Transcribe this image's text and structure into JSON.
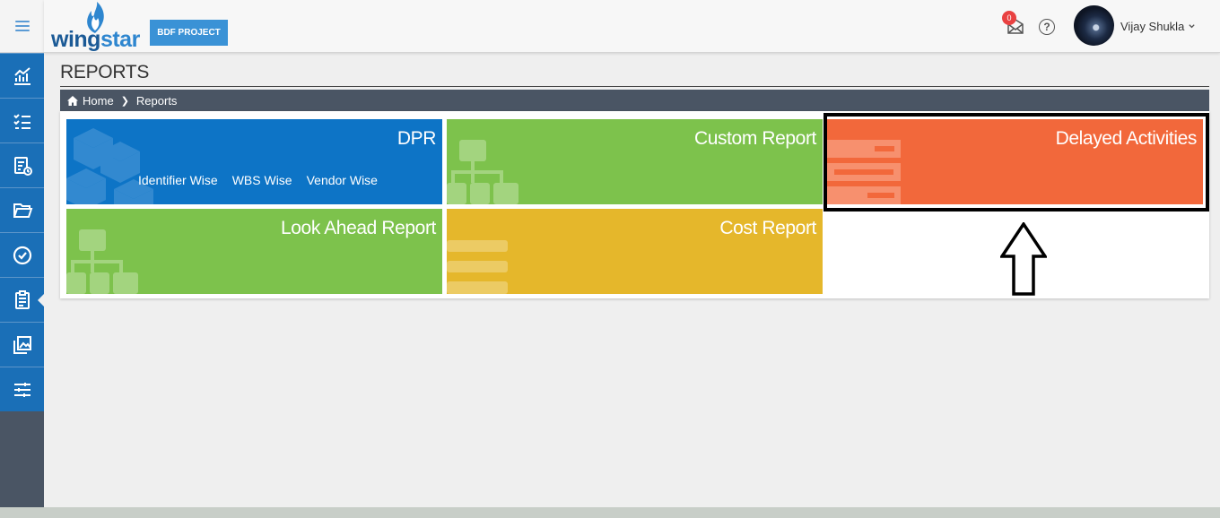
{
  "app": {
    "logo_word_1": "wing",
    "logo_word_2": "star",
    "project_label": "BDF PROJECT"
  },
  "header": {
    "notifications_count": "0",
    "user_name": "Vijay Shukla",
    "help_glyph": "?"
  },
  "sidebar": {
    "items": [
      {
        "icon": "analytics-icon"
      },
      {
        "icon": "checklist-icon"
      },
      {
        "icon": "report-clock-icon"
      },
      {
        "icon": "folder-open-icon"
      },
      {
        "icon": "check-circle-icon"
      },
      {
        "icon": "clipboard-icon",
        "active": true
      },
      {
        "icon": "gallery-icon"
      },
      {
        "icon": "sliders-icon"
      }
    ]
  },
  "page": {
    "title": "REPORTS"
  },
  "breadcrumb": {
    "home": "Home",
    "current": "Reports"
  },
  "tiles": {
    "dpr": {
      "title": "DPR",
      "links": [
        "Identifier Wise",
        "WBS Wise",
        "Vendor Wise"
      ]
    },
    "custom": {
      "title": "Custom Report"
    },
    "delayed": {
      "title": "Delayed Activities"
    },
    "look_ahead": {
      "title": "Look Ahead Report"
    },
    "cost": {
      "title": "Cost Report"
    }
  },
  "colors": {
    "sidebar_blue": "#1a6fb7",
    "dpr": "#0d74c6",
    "green": "#7dc24c",
    "delayed": "#f2683b",
    "cost": "#e5b72b"
  }
}
